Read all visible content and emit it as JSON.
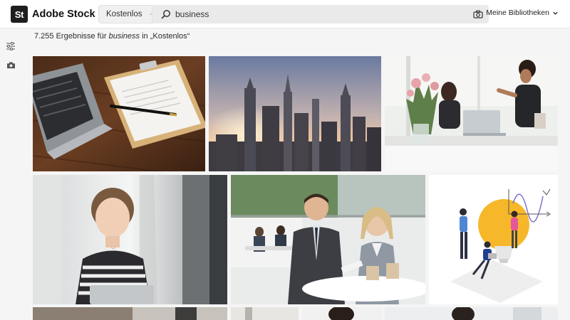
{
  "header": {
    "logo_mark": "St",
    "logo_name": "Adobe Stock",
    "scope_label": "Kostenlos",
    "search_value": "business",
    "libraries_label": "Meine Bibliotheken"
  },
  "results": {
    "count": "7.255",
    "prefix": "Ergebnisse für",
    "term": "business",
    "mid": "in",
    "scope": "„Kostenlos“"
  },
  "icons": {
    "logo": "adobe-stock-logo",
    "scope_chevron": "chevron-down-icon",
    "search": "search-icon",
    "visual_search": "camera-icon",
    "libraries_chevron": "chevron-down-icon",
    "filters": "sliders-icon",
    "rail_camera": "camera-icon"
  },
  "colors": {
    "header_bg": "#ffffff",
    "page_bg": "#f5f5f5",
    "logo_bg": "#1e1e1e"
  },
  "tiles": [
    "laptop-with-clipboard-and-pen",
    "city-skyline-at-sunset",
    "two-women-working-at-desk",
    "smiling-woman-holding-laptop",
    "businessman-and-businesswoman-at-table",
    "illustration-people-with-lightbulb-and-charts",
    "partial-row-office-scene",
    "partial-row-office-scene",
    "partial-row-office-scene",
    "partial-row-office-scene"
  ]
}
